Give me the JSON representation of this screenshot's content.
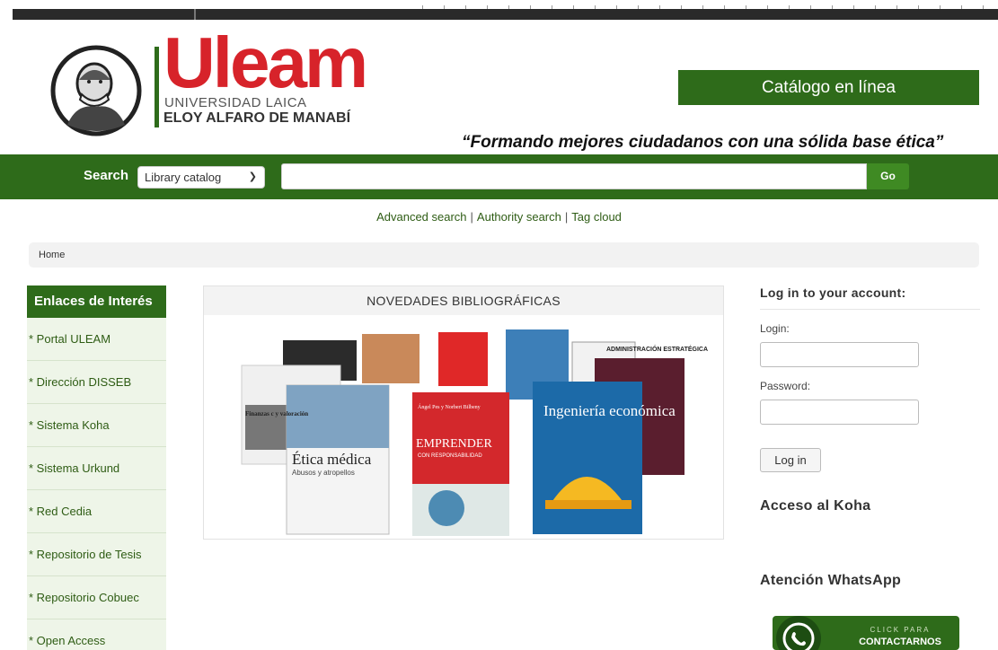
{
  "header": {
    "brand_name": "Uleam",
    "brand_sub1": "UNIVERSIDAD LAICA",
    "brand_sub2": "ELOY ALFARO DE MANABÍ",
    "catalog_button": "Catálogo en línea",
    "motto": "“Formando mejores ciudadanos con una sólida base ética”"
  },
  "search": {
    "label": "Search",
    "selected_catalog": "Library catalog",
    "go_label": "Go"
  },
  "links": {
    "advanced": "Advanced search",
    "authority": "Authority search",
    "tag_cloud": "Tag cloud",
    "separator": "|"
  },
  "breadcrumb": {
    "home": "Home"
  },
  "sidebar": {
    "title": "Enlaces de Interés",
    "items": [
      {
        "label": "* Portal ULEAM"
      },
      {
        "label": "* Dirección DISSEB"
      },
      {
        "label": "* Sistema Koha"
      },
      {
        "label": "* Sistema Urkund"
      },
      {
        "label": "* Red Cedia"
      },
      {
        "label": "* Repositorio de Tesis"
      },
      {
        "label": "* Repositorio Cobuec"
      },
      {
        "label": "* Open Access"
      }
    ]
  },
  "novedades": {
    "title": "NOVEDADES BIBLIOGRÁFICAS",
    "books": [
      {
        "title": "Ética médica",
        "subtitle": "Abusos y atropellos"
      },
      {
        "title": "EMPRENDER",
        "subtitle": "CON RESPONSABILIDAD",
        "authors": "Ángel Pes y Norbert Bilbeny"
      },
      {
        "title": "Ingeniería económica"
      },
      {
        "title": "ADMINISTRACIÓN ESTRATÉGICA"
      },
      {
        "title": "Finanzas c y valoración"
      }
    ]
  },
  "login": {
    "title": "Log in to your account:",
    "login_label": "Login:",
    "password_label": "Password:",
    "button": "Log in"
  },
  "koha_title": "Acceso al Koha",
  "whatsapp": {
    "title": "Atención WhatsApp",
    "cta_top": "CLICK PARA",
    "cta_main": "CONTACTARNOS"
  },
  "colors": {
    "brand_green": "#2e6b1a",
    "brand_red": "#d7232a",
    "link_green": "#2e5c14"
  }
}
